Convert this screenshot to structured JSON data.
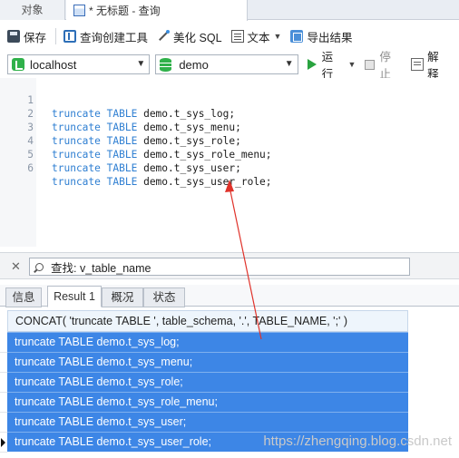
{
  "tabs": [
    {
      "label": "对象"
    },
    {
      "label": "* 无标题 - 查询"
    }
  ],
  "toolbar": {
    "save": "保存",
    "query_builder": "查询创建工具",
    "beautify_sql": "美化 SQL",
    "text": "文本",
    "export_results": "导出结果"
  },
  "connection": {
    "host": "localhost",
    "database": "demo",
    "run": "运行",
    "stop": "停止",
    "explain": "解释"
  },
  "editor": {
    "lines": [
      {
        "num": "1",
        "kw1": "truncate",
        "kw2": "TABLE",
        "target": "demo.t_sys_log;"
      },
      {
        "num": "2",
        "kw1": "truncate",
        "kw2": "TABLE",
        "target": "demo.t_sys_menu;"
      },
      {
        "num": "3",
        "kw1": "truncate",
        "kw2": "TABLE",
        "target": "demo.t_sys_role;"
      },
      {
        "num": "4",
        "kw1": "truncate",
        "kw2": "TABLE",
        "target": "demo.t_sys_role_menu;"
      },
      {
        "num": "5",
        "kw1": "truncate",
        "kw2": "TABLE",
        "target": "demo.t_sys_user;"
      },
      {
        "num": "6",
        "kw1": "truncate",
        "kw2": "TABLE",
        "target": "demo.t_sys_user_role;"
      }
    ]
  },
  "find": {
    "value": "查找: v_table_name"
  },
  "result_tabs": [
    {
      "label": "信息"
    },
    {
      "label": "Result 1"
    },
    {
      "label": "概况"
    },
    {
      "label": "状态"
    }
  ],
  "grid": {
    "column": "CONCAT( 'truncate TABLE ', table_schema, '.', TABLE_NAME, ';' )",
    "rows": [
      "truncate TABLE demo.t_sys_log;",
      "truncate TABLE demo.t_sys_menu;",
      "truncate TABLE demo.t_sys_role;",
      "truncate TABLE demo.t_sys_role_menu;",
      "truncate TABLE demo.t_sys_user;",
      "truncate TABLE demo.t_sys_user_role;"
    ]
  },
  "watermark": "https://zhengqing.blog.csdn.net",
  "colors": {
    "keyword": "#2f7fd2",
    "selection": "#3d86e6",
    "annotation": "#e0322a"
  }
}
